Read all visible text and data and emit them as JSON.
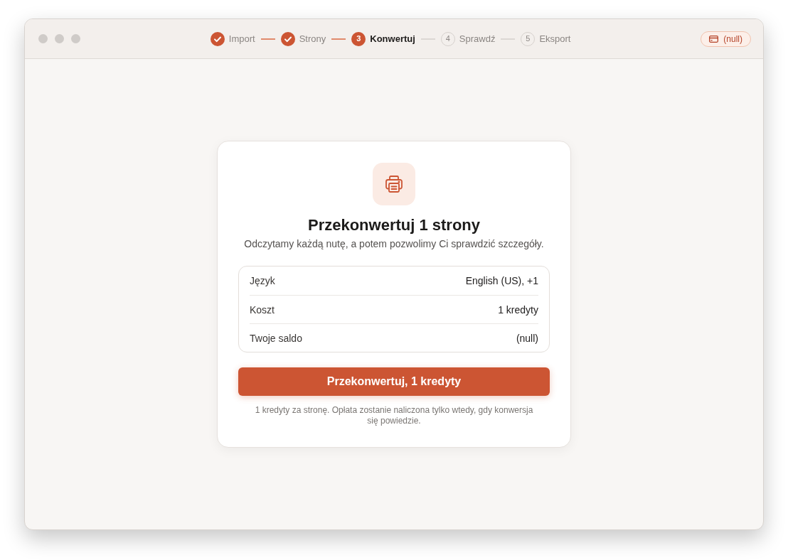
{
  "stepper": {
    "steps": [
      {
        "label": "Import",
        "done": true,
        "selected": false
      },
      {
        "label": "Strony",
        "done": true,
        "selected": false
      },
      {
        "label": "Konwertuj",
        "done": false,
        "selected": true,
        "number": "3"
      },
      {
        "label": "Sprawdź",
        "done": false,
        "selected": false,
        "number": "4"
      },
      {
        "label": "Eksport",
        "done": false,
        "selected": false,
        "number": "5"
      }
    ]
  },
  "credits_badge": {
    "text": "(null)"
  },
  "dialog": {
    "title": "Przekonwertuj 1 strony",
    "subtitle": "Odczytamy każdą nutę, a potem pozwolimy Ci sprawdzić szczegóły.",
    "details": [
      {
        "label": "Język",
        "value": "English (US), +1"
      },
      {
        "label": "Koszt",
        "value": "1 kredyty"
      },
      {
        "label": "Twoje saldo",
        "value": "(null)"
      }
    ],
    "primary_button": "Przekonwertuj, 1 kredyty",
    "note": "1 kredyty za stronę. Opłata zostanie naliczona tylko wtedy, gdy konwersja się powiedzie."
  }
}
